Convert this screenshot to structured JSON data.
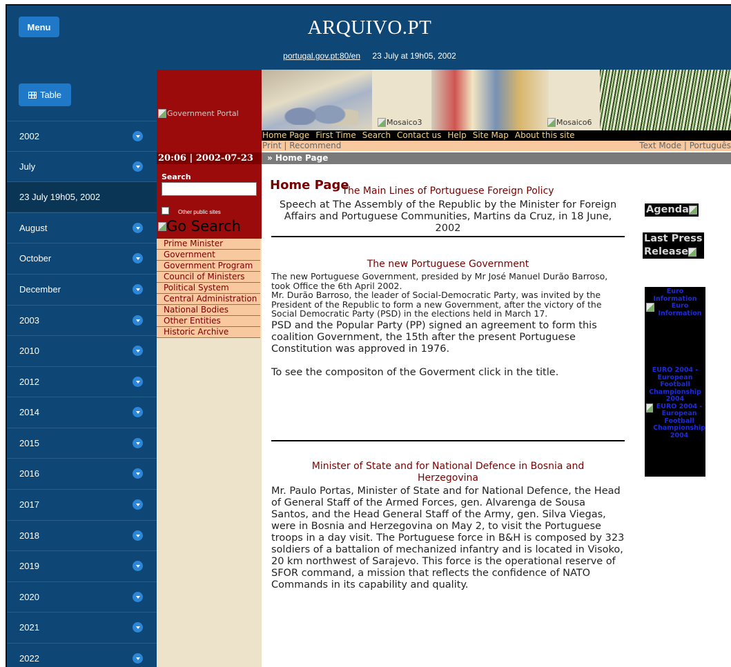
{
  "archive": {
    "menu_label": "Menu",
    "brand": "ARQUIVO.PT",
    "url": "portugal.gov.pt:80/en",
    "capture_date": "23 July at 19h05, 2002",
    "table_label": "Table"
  },
  "sidebar": {
    "items": [
      {
        "label": "2002",
        "chevron": true
      },
      {
        "label": "July",
        "chevron": true
      },
      {
        "label": "23 July 19h05, 2002",
        "chevron": false,
        "selected": true
      },
      {
        "label": "August",
        "chevron": true
      },
      {
        "label": "October",
        "chevron": true
      },
      {
        "label": "December",
        "chevron": true
      },
      {
        "label": "2003",
        "chevron": true
      },
      {
        "label": "2010",
        "chevron": true
      },
      {
        "label": "2012",
        "chevron": true
      },
      {
        "label": "2014",
        "chevron": true
      },
      {
        "label": "2015",
        "chevron": true
      },
      {
        "label": "2016",
        "chevron": true
      },
      {
        "label": "2017",
        "chevron": true
      },
      {
        "label": "2018",
        "chevron": true
      },
      {
        "label": "2019",
        "chevron": true
      },
      {
        "label": "2020",
        "chevron": true
      },
      {
        "label": "2021",
        "chevron": true
      },
      {
        "label": "2022",
        "chevron": true
      }
    ]
  },
  "site": {
    "logo_alt": "Government Portal",
    "mosaic3_alt": "Mosaico3",
    "mosaic6_alt": "Mosaico6",
    "nav": [
      "Home Page",
      "First Time",
      "Search",
      "Contact us",
      "Help",
      "Site Map",
      "About this site"
    ],
    "print_links": "Print | Recommend",
    "mode_links": "Text Mode |  Português",
    "datetime": "20:06 | 2002-07-23",
    "breadcrumb": "» Home Page",
    "search_label": "Search",
    "other_sites_label": "Other public sites",
    "go_search_alt": "Go Search",
    "left_nav": [
      "Prime Minister",
      "Government",
      "Government Program",
      "Council of Ministers",
      "Political System",
      "Central Administration",
      "National Bodies",
      "Other Entities",
      "Historic Archive"
    ]
  },
  "main": {
    "page_title": "Home Page",
    "article1": {
      "title": "The Main Lines of Portuguese Foreign Policy",
      "body": "Speech at The Assembly of the Republic by the Minister for Foreign Affairs and Portuguese Communities, Martins da Cruz, in 18 June, 2002"
    },
    "article2": {
      "title": "The new Portuguese Government",
      "small": "The new Portuguese Government, presided by Mr José Manuel Durão Barroso, took Office the 6th April 2002.\nMr. Durão Barroso, the leader of Social-Democratic Party, was invited by the President of the Republic to form a new Government, after the victory of the Social Democratic Party (PSD) in the elections held in March 17.",
      "body": "PSD and the Popular Party (PP) signed an agreement to form this coalition Government, the 15th after the present Portuguese Constitution was approved in 1976.",
      "footer": "To see the compositon of the Goverment click in the title."
    },
    "article3": {
      "title": "Minister of State and for National Defence in Bosnia and Herzegovina",
      "body": "Mr. Paulo Portas, Minister of State and for National Defence, the Head of General Staff of the Armed Forces, gen. Alvarenga de Sousa Santos, and the Head General Staff of the Army, gen. Silva Viegas, were in Bosnia and Herzegovina on May 2, to visit the Portuguese troops in a day visit. The Portuguese force in B&H is composed by 323 soldiers of a battalion of mechanized infantry and is located in Visoko, 20 km northwest of Sarajevo. This force is the operational reserve of SFOR command, a mission that reflects the confidence of NATO Commands in its capability and quality."
    },
    "right": {
      "agenda": "Agenda",
      "press_line1": "Last Press",
      "press_line2": "Release",
      "euro_info_link": "Euro Information",
      "euro_info_alt": "Euro Information",
      "euro2004_link": "EURO 2004 - European Football Championship 2004",
      "euro2004_alt": "EURO 2004 - European Football Championship 2004"
    }
  }
}
